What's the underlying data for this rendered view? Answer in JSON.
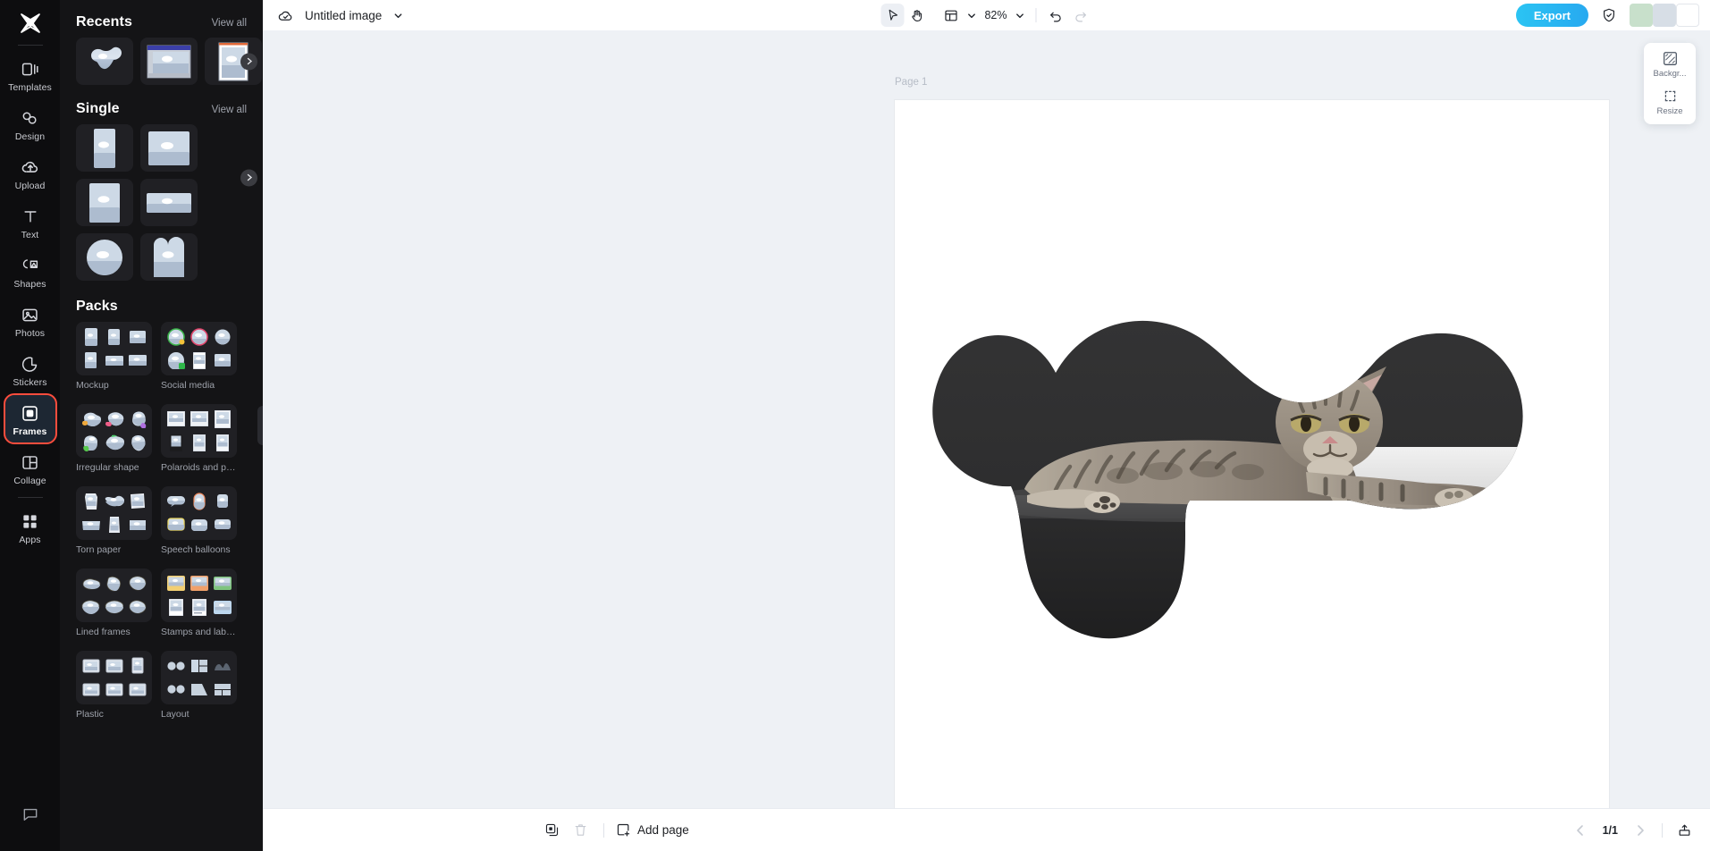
{
  "app": {
    "name": "CapCut Image Editor",
    "accent_color": "#27b6f2",
    "highlight_color": "#ff4d3d",
    "rail_bg": "#0d0d0f",
    "panel_bg": "#141416",
    "stage_bg": "#eef1f5"
  },
  "rail": {
    "logo_name": "capcut-logo",
    "items": [
      {
        "label": "Templates",
        "icon": "templates-icon",
        "active": false,
        "highlight": false
      },
      {
        "label": "Design",
        "icon": "design-icon",
        "active": false,
        "highlight": false
      },
      {
        "label": "Upload",
        "icon": "upload-cloud-icon",
        "active": false,
        "highlight": false
      },
      {
        "label": "Text",
        "icon": "text-icon",
        "active": false,
        "highlight": false
      },
      {
        "label": "Shapes",
        "icon": "shapes-icon",
        "active": false,
        "highlight": false
      },
      {
        "label": "Photos",
        "icon": "photos-icon",
        "active": false,
        "highlight": false
      },
      {
        "label": "Stickers",
        "icon": "stickers-icon",
        "active": false,
        "highlight": false
      },
      {
        "label": "Frames",
        "icon": "frames-icon",
        "active": true,
        "highlight": true
      },
      {
        "label": "Collage",
        "icon": "collage-icon",
        "active": false,
        "highlight": false
      },
      {
        "label": "Apps",
        "icon": "apps-grid-icon",
        "active": false,
        "highlight": false
      }
    ],
    "bottom_icon": "feedback-icon"
  },
  "panel": {
    "sections": [
      {
        "title": "Recents",
        "view_all": "View all"
      },
      {
        "title": "Single",
        "view_all": "View all"
      },
      {
        "title": "Packs",
        "view_all": ""
      }
    ],
    "recents_count": 3,
    "single_count": 6,
    "next_arrow_icon": "chevron-right-icon",
    "packs": [
      {
        "label": "Mockup"
      },
      {
        "label": "Social media"
      },
      {
        "label": "Irregular shape"
      },
      {
        "label": "Polaroids and phot..."
      },
      {
        "label": "Torn paper"
      },
      {
        "label": "Speech balloons"
      },
      {
        "label": "Lined frames"
      },
      {
        "label": "Stamps and labels"
      },
      {
        "label": "Plastic"
      },
      {
        "label": "Layout"
      }
    ],
    "resize_handle": "panel-resize-handle"
  },
  "toolbar": {
    "cloud_icon": "cloud-saved-icon",
    "doc_title": "Untitled image",
    "doc_chevron": "chevron-down-icon",
    "select_tool_icon": "cursor-arrow-icon",
    "hand_tool_icon": "hand-icon",
    "layout_icon": "layout-panels-icon",
    "layout_chevron": "chevron-down-icon",
    "zoom_value": "82%",
    "zoom_chevron": "chevron-down-icon",
    "undo_icon": "undo-icon",
    "redo_icon": "redo-icon",
    "export_label": "Export",
    "shield_icon": "shield-check-icon",
    "avatar_count": 3
  },
  "float_panel": {
    "items": [
      {
        "label": "Backgr...",
        "icon": "background-hatch-icon"
      },
      {
        "label": "Resize",
        "icon": "resize-frame-icon"
      }
    ]
  },
  "canvas": {
    "page_label": "Page 1",
    "artwork": {
      "name": "cat-photo-in-irregular-frame",
      "subject": "tabby cat lying on a dark shelf",
      "mask_shape": "organic blob / irregular frame",
      "background_color": "#2f2f30"
    }
  },
  "bottombar": {
    "duplicate_icon": "duplicate-page-icon",
    "delete_icon": "trash-icon",
    "add_page_label": "Add page",
    "add_page_icon": "add-page-icon",
    "prev_icon": "chevron-left-icon",
    "next_icon": "chevron-right-icon",
    "page_count": "1/1",
    "present_icon": "export-up-icon"
  }
}
